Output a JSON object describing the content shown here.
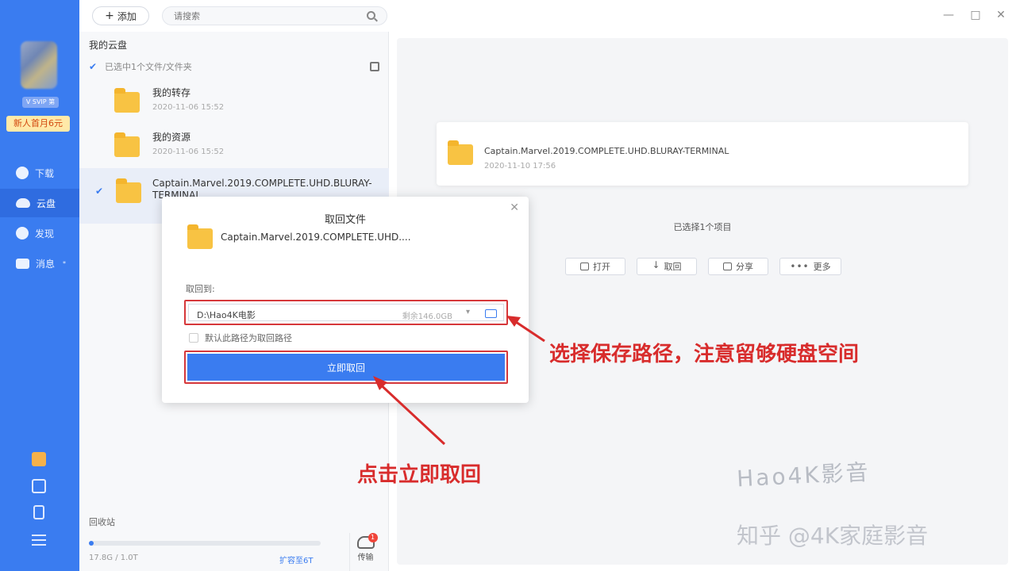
{
  "sidebar": {
    "vip_label": "V SVIP 第",
    "promo": "新人首月6元",
    "nav": [
      {
        "label": "下载",
        "icon": "download-icon"
      },
      {
        "label": "云盘",
        "icon": "cloud-icon"
      },
      {
        "label": "发现",
        "icon": "discover-icon"
      },
      {
        "label": "消息",
        "icon": "message-icon",
        "badge": "*"
      }
    ]
  },
  "topbar": {
    "add_label": "添加",
    "search_placeholder": "请搜索",
    "window_controls": [
      "—",
      "□",
      "✕"
    ]
  },
  "list": {
    "title": "我的云盘",
    "selection_text": "已选中1个文件/文件夹",
    "files": [
      {
        "name": "我的转存",
        "date": "2020-11-06 15:52"
      },
      {
        "name": "我的资源",
        "date": "2020-11-06 15:52"
      },
      {
        "name": "Captain.Marvel.2019.COMPLETE.UHD.BLURAY-TERMINAL",
        "date": "2020-11-10 17:56"
      }
    ],
    "recycle_label": "回收站",
    "quota_text": "17.8G / 1.0T",
    "quota_fraction": 0.017,
    "expand_link": "扩容至6T",
    "transfer_label": "传输",
    "transfer_badge": "1"
  },
  "detail": {
    "file_name": "Captain.Marvel.2019.COMPLETE.UHD.BLURAY-TERMINAL",
    "file_date": "2020-11-10 17:56",
    "selected_count": "已选择1个项目",
    "actions": [
      "打开",
      "取回",
      "分享",
      "更多"
    ]
  },
  "dialog": {
    "title": "取回文件",
    "file_name": "Captain.Marvel.2019.COMPLETE.UHD....",
    "save_to_label": "取回到:",
    "path_value": "D:\\Hao4K电影",
    "free_space": "剩余146.0GB",
    "default_path_label": "默认此路径为取回路径",
    "confirm_label": "立即取回"
  },
  "annotations": {
    "path_hint": "选择保存路径，注意留够硬盘空间",
    "click_hint": "点击立即取回"
  },
  "watermarks": {
    "brand": "Hao4K影音",
    "zhihu": "知乎 @4K家庭影音"
  },
  "colors": {
    "accent": "#3a7cf0",
    "annotation": "#d82c2c",
    "folder": "#f8c343"
  }
}
